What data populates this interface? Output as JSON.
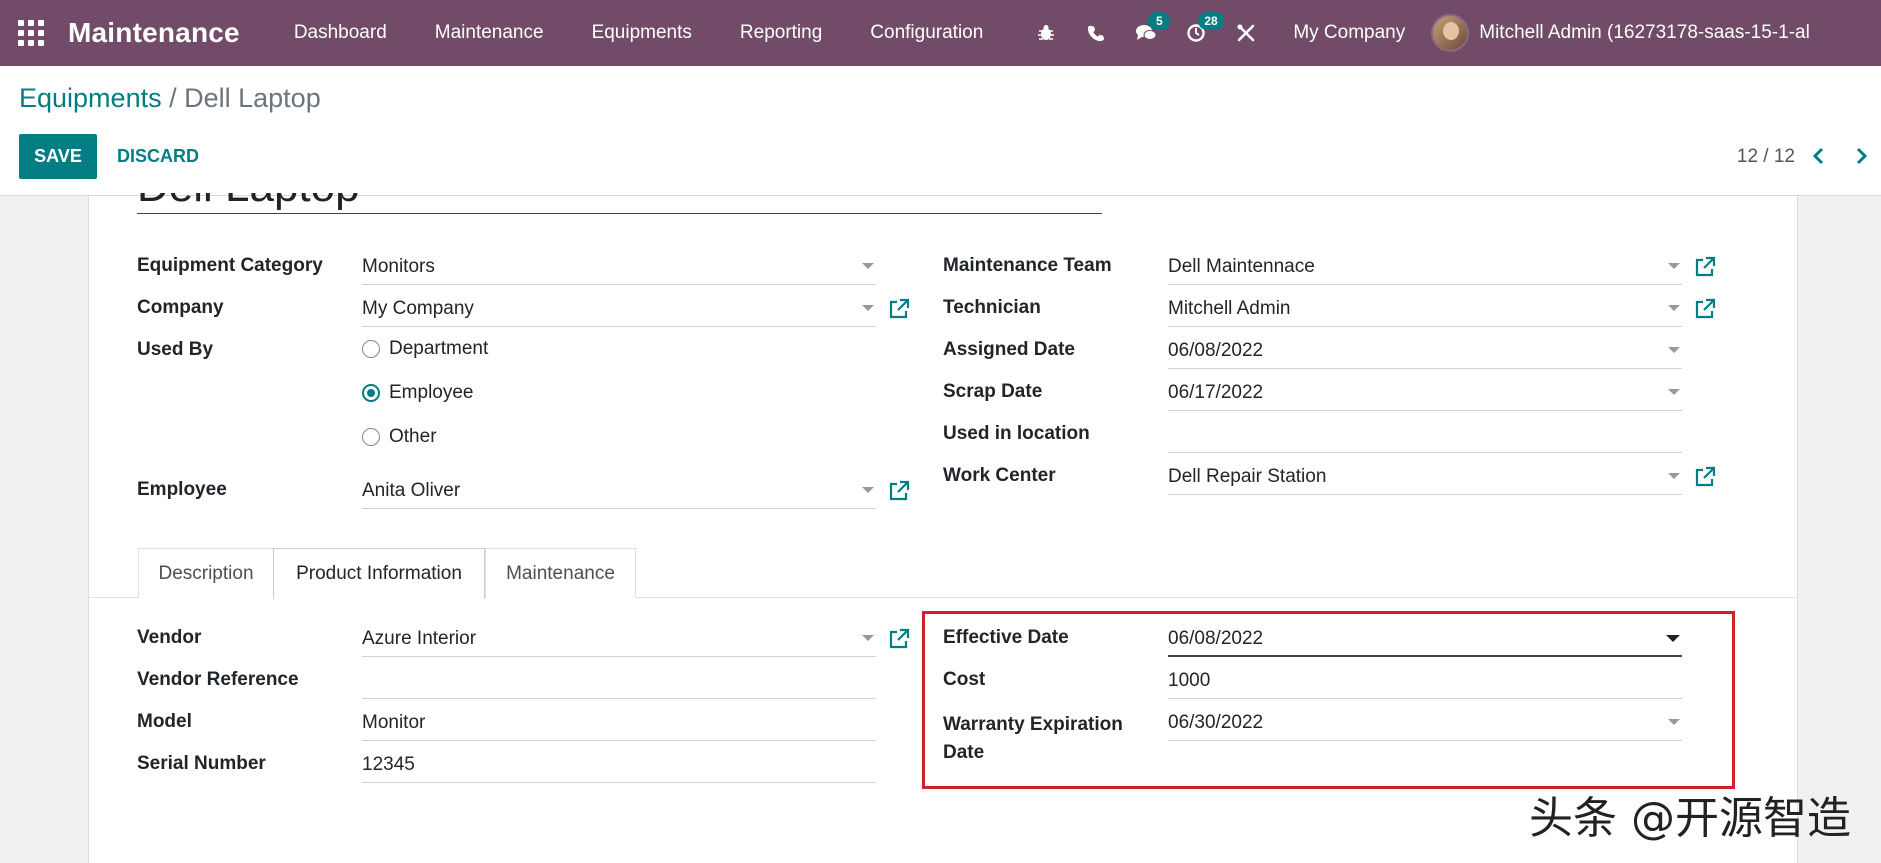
{
  "navbar": {
    "app_name": "Maintenance",
    "menu": [
      "Dashboard",
      "Maintenance",
      "Equipments",
      "Reporting",
      "Configuration"
    ],
    "icons": [
      "bug-icon",
      "phone-icon",
      "chat-icon",
      "clock-icon",
      "tools-icon"
    ],
    "chat_badge": "5",
    "activity_badge": "28",
    "company": "My Company",
    "user": "Mitchell Admin (16273178-saas-15-1-al"
  },
  "breadcrumb": {
    "parent": "Equipments",
    "separator": " / ",
    "current": "Dell Laptop"
  },
  "buttons": {
    "save": "SAVE",
    "discard": "DISCARD"
  },
  "pager": {
    "value": "12 / 12"
  },
  "record": {
    "title": "Dell Laptop"
  },
  "left_fields": {
    "equipment_category": {
      "label": "Equipment Category",
      "value": "Monitors"
    },
    "company": {
      "label": "Company",
      "value": "My Company"
    },
    "used_by": {
      "label": "Used By",
      "options": [
        "Department",
        "Employee",
        "Other"
      ],
      "selected": "Employee"
    },
    "employee": {
      "label": "Employee",
      "value": "Anita Oliver"
    }
  },
  "right_fields": {
    "maintenance_team": {
      "label": "Maintenance Team",
      "value": "Dell Maintennace"
    },
    "technician": {
      "label": "Technician",
      "value": "Mitchell Admin"
    },
    "assigned_date": {
      "label": "Assigned Date",
      "value": "06/08/2022"
    },
    "scrap_date": {
      "label": "Scrap Date",
      "value": "06/17/2022"
    },
    "used_in_location": {
      "label": "Used in location",
      "value": ""
    },
    "work_center": {
      "label": "Work Center",
      "value": "Dell Repair Station"
    }
  },
  "tabs": [
    {
      "label": "Description",
      "active": false
    },
    {
      "label": "Product Information",
      "active": true
    },
    {
      "label": "Maintenance",
      "active": false
    }
  ],
  "product_info": {
    "vendor": {
      "label": "Vendor",
      "value": "Azure Interior"
    },
    "vendor_reference": {
      "label": "Vendor Reference",
      "value": ""
    },
    "model": {
      "label": "Model",
      "value": "Monitor"
    },
    "serial_number": {
      "label": "Serial Number",
      "value": "12345"
    },
    "effective_date": {
      "label": "Effective Date",
      "value": "06/08/2022"
    },
    "cost": {
      "label": "Cost",
      "value": "1000"
    },
    "warranty_expiration_date": {
      "label_line1": "Warranty Expiration",
      "label_line2": "Date",
      "value": "06/30/2022"
    }
  },
  "watermark": {
    "text": "头条 @开源智造"
  },
  "colors": {
    "navbar": "#714b67",
    "primary": "#017e84",
    "highlight": "#d0202e"
  }
}
